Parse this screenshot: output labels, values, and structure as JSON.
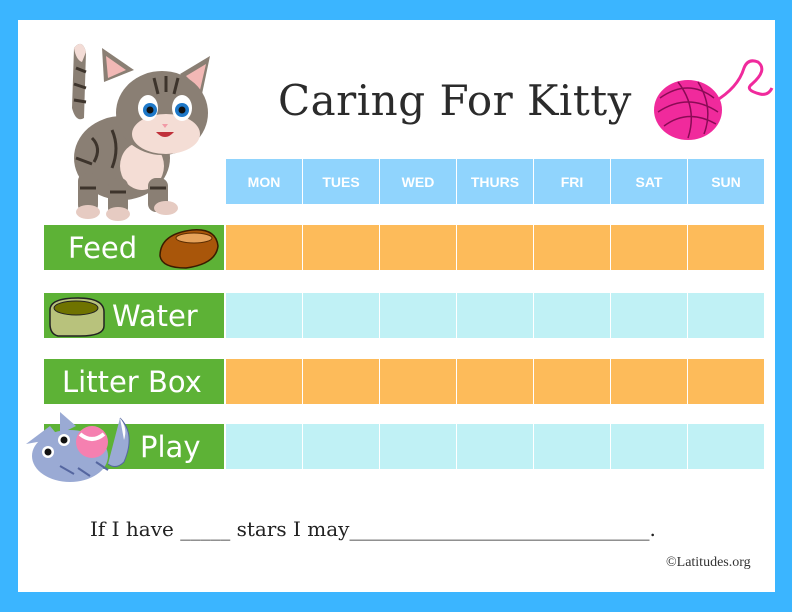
{
  "title": "Caring For Kitty",
  "days": [
    "MON",
    "TUES",
    "WED",
    "THURS",
    "FRI",
    "SAT",
    "SUN"
  ],
  "tasks": [
    {
      "label": "Feed",
      "icon": "food-bowl-icon",
      "row_color": "orange"
    },
    {
      "label": "Water",
      "icon": "water-bowl-icon",
      "row_color": "cyan"
    },
    {
      "label": "Litter Box",
      "icon": "",
      "row_color": "orange"
    },
    {
      "label": "Play",
      "icon": "kitten-playing-icon",
      "row_color": "cyan"
    }
  ],
  "footer": {
    "sentence_part1": "If I have",
    "blank_short": "_____",
    "sentence_part2": "stars I may",
    "blank_long": "______________________________",
    "period": "."
  },
  "copyright": "©Latitudes.org",
  "colors": {
    "border": "#3bb5ff",
    "header": "#90d4fd",
    "label": "#5db236",
    "orange": "#fdbb5a",
    "cyan": "#c0f1f5"
  }
}
